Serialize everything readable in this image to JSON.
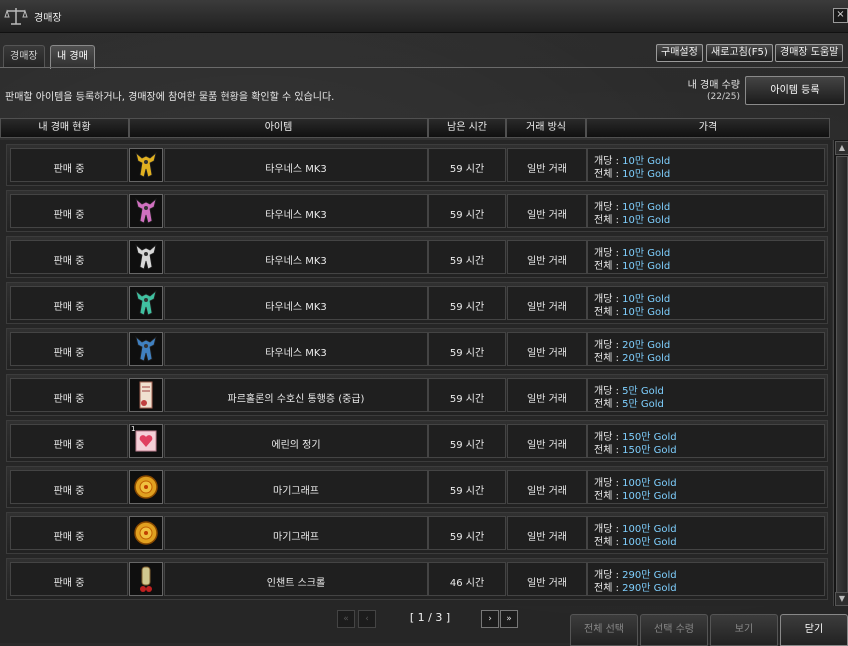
{
  "window": {
    "title": "경매장",
    "close_label": "×"
  },
  "tabs": [
    {
      "label": "경매장",
      "active": false
    },
    {
      "label": "내 경매",
      "active": true
    }
  ],
  "toolbar": {
    "buy_settings": "구매설정",
    "refresh": "새로고침(F5)",
    "help": "경매장 도움말"
  },
  "description": "판매할 아이템을 등록하거나, 경매장에 참여한 물품 현황을 확인할 수 있습니다.",
  "auction_count": {
    "label": "내 경매 수량",
    "value": "(22/25)"
  },
  "register_button": "아이템 등록",
  "columns": [
    "내 경매 현황",
    "아이템",
    "남은 시간",
    "거래 방식",
    "가격"
  ],
  "price_labels": {
    "unit": "개당 :",
    "total": "전체 :"
  },
  "rows": [
    {
      "status": "판매 중",
      "item": "타우네스 MK3",
      "icon": "armor-gold-icon",
      "time": "59 시간",
      "method": "일반 거래",
      "unit_price": "10만 Gold",
      "total_price": "10만 Gold",
      "qty": ""
    },
    {
      "status": "판매 중",
      "item": "타우네스 MK3",
      "icon": "armor-pink-icon",
      "time": "59 시간",
      "method": "일반 거래",
      "unit_price": "10만 Gold",
      "total_price": "10만 Gold",
      "qty": ""
    },
    {
      "status": "판매 중",
      "item": "타우네스 MK3",
      "icon": "armor-white-icon",
      "time": "59 시간",
      "method": "일반 거래",
      "unit_price": "10만 Gold",
      "total_price": "10만 Gold",
      "qty": ""
    },
    {
      "status": "판매 중",
      "item": "타우네스 MK3",
      "icon": "armor-teal-icon",
      "time": "59 시간",
      "method": "일반 거래",
      "unit_price": "10만 Gold",
      "total_price": "10만 Gold",
      "qty": ""
    },
    {
      "status": "판매 중",
      "item": "타우네스 MK3",
      "icon": "armor-blue-icon",
      "time": "59 시간",
      "method": "일반 거래",
      "unit_price": "20만 Gold",
      "total_price": "20만 Gold",
      "qty": ""
    },
    {
      "status": "판매 중",
      "item": "파르홀론의 수호신 통행증 (중급)",
      "icon": "pass-ticket-icon",
      "time": "59 시간",
      "method": "일반 거래",
      "unit_price": "5만 Gold",
      "total_price": "5만 Gold",
      "qty": ""
    },
    {
      "status": "판매 중",
      "item": "에린의 정기",
      "icon": "heart-card-icon",
      "time": "59 시간",
      "method": "일반 거래",
      "unit_price": "150만 Gold",
      "total_price": "150만 Gold",
      "qty": "1"
    },
    {
      "status": "판매 중",
      "item": "마기그래프",
      "icon": "gold-medal-icon",
      "time": "59 시간",
      "method": "일반 거래",
      "unit_price": "100만 Gold",
      "total_price": "100만 Gold",
      "qty": ""
    },
    {
      "status": "판매 중",
      "item": "마기그래프",
      "icon": "gold-medal-icon",
      "time": "59 시간",
      "method": "일반 거래",
      "unit_price": "100만 Gold",
      "total_price": "100만 Gold",
      "qty": ""
    },
    {
      "status": "판매 중",
      "item": "인챈트 스크롤",
      "icon": "enchant-scroll-icon",
      "time": "46 시간",
      "method": "일반 거래",
      "unit_price": "290만 Gold",
      "total_price": "290만 Gold",
      "qty": ""
    }
  ],
  "pagination": {
    "label": "[ 1 / 3 ]",
    "first": "«",
    "prev": "‹",
    "next": "›",
    "last": "»"
  },
  "bottom_buttons": [
    {
      "label": "전체 선택",
      "enabled": false
    },
    {
      "label": "선택 수령",
      "enabled": false
    },
    {
      "label": "보기",
      "enabled": false
    },
    {
      "label": "닫기",
      "enabled": true
    }
  ],
  "colors": {
    "price": "#7fd0ff",
    "gold": "#e0b020",
    "pink": "#d070c0",
    "white": "#d8d8d8",
    "teal": "#40c0a0",
    "blue": "#4080c0"
  }
}
